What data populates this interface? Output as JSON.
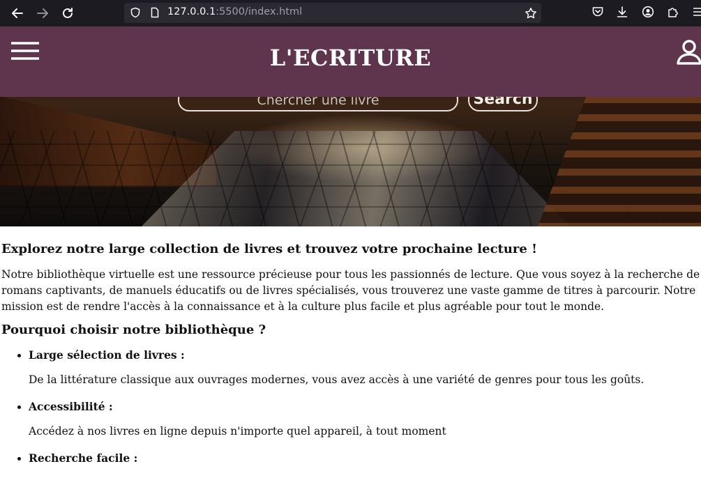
{
  "browser": {
    "url_host": "127.0.0.1",
    "url_rest": ":5500/index.html"
  },
  "header": {
    "title": "L'ECRITURE"
  },
  "search": {
    "placeholder": "Chercher une livre",
    "button_label": "Search"
  },
  "main": {
    "heading": "Explorez notre large collection de livres et trouvez votre prochaine lecture !",
    "intro": "Notre bibliothèque virtuelle est une ressource précieuse pour tous les passionnés de lecture. Que vous soyez à la recherche de romans captivants, de manuels éducatifs ou de livres spécialisés, vous trouverez une vaste gamme de titres à parcourir. Notre mission est de rendre l'accès à la connaissance et à la culture plus facile et plus agréable pour tout le monde.",
    "why_heading": "Pourquoi choisir notre bibliothèque ?",
    "features": [
      {
        "title": "Large sélection de livres :",
        "description": "De la littérature classique aux ouvrages modernes, vous avez accès à une variété de genres pour tous les goûts."
      },
      {
        "title": "Accessibilité :",
        "description": "Accédez à nos livres en ligne depuis n'importe quel appareil, à tout moment"
      },
      {
        "title": "Recherche facile :",
        "description": ""
      }
    ]
  },
  "colors": {
    "header_bg": "#5e354c",
    "browser_bg": "#1c1b22",
    "url_bar_bg": "#2b2a33"
  },
  "icons": [
    "back-arrow-icon",
    "forward-arrow-icon",
    "reload-icon",
    "shield-icon",
    "page-icon",
    "star-icon",
    "pocket-icon",
    "download-icon",
    "account-icon",
    "extensions-icon",
    "menu-icon",
    "hamburger-menu-icon",
    "user-icon"
  ]
}
